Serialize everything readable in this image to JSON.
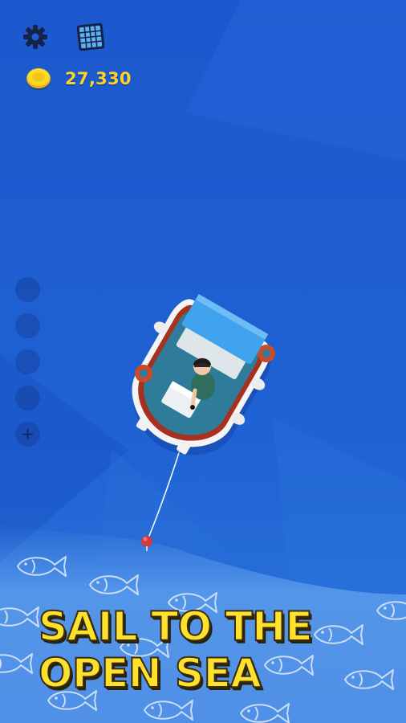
{
  "hud": {
    "coins": "27,330",
    "settings_icon": "gear-icon",
    "map_icon": "map-grid-icon",
    "coin_icon": "gold-coin-icon"
  },
  "sidebar": {
    "slots": [
      {
        "state": "empty"
      },
      {
        "state": "empty"
      },
      {
        "state": "empty"
      },
      {
        "state": "empty"
      },
      {
        "state": "add",
        "icon": "plus-icon"
      }
    ]
  },
  "promo": {
    "line1": "SAIL TO THE",
    "line2": "OPEN SEA"
  },
  "colors": {
    "sea": "#1f5fd0",
    "coin_text": "#ffd21f",
    "promo_text": "#fde12c",
    "boat_roof": "#3fa3ee",
    "boat_trim": "#a8301e"
  }
}
